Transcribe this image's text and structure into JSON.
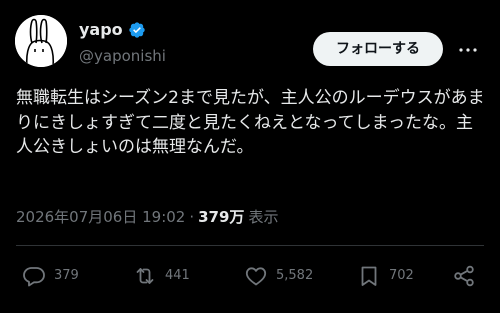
{
  "author": {
    "display_name": "yapo",
    "handle": "@yaponishi",
    "verified": true
  },
  "follow_label": "フォローする",
  "tweet_text": "無職転生はシーズン2まで見たが、主人公のルーデウスがあまりにきしょすぎて二度と見たくねえとなってしまったな。主人公きしょいのは無理なんだ。",
  "meta": {
    "timestamp": "2026年07月06日 19:02",
    "separator": "·",
    "views_count": "379万",
    "views_label": "表示"
  },
  "actions": {
    "replies": "379",
    "retweets": "441",
    "likes": "5,582",
    "bookmarks": "702"
  },
  "colors": {
    "background": "#000000",
    "text_primary": "#e7e9ea",
    "text_secondary": "#71767b",
    "verified_blue": "#1d9bf0",
    "follow_bg": "#eff3f4"
  },
  "icons": [
    "avatar-rabbit",
    "verified-badge-icon",
    "more-icon",
    "reply-icon",
    "retweet-icon",
    "like-icon",
    "bookmark-icon",
    "share-icon"
  ]
}
